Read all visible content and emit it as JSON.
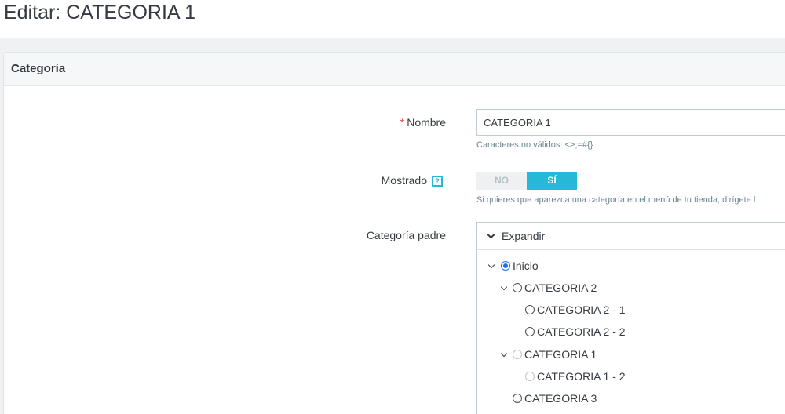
{
  "page": {
    "title": "Editar: CATEGORIA 1"
  },
  "panel": {
    "heading": "Categoría"
  },
  "form": {
    "name": {
      "required_mark": "*",
      "label": "Nombre",
      "value": "CATEGORIA 1",
      "hint": "Caracteres no válidos: <>;=#{}"
    },
    "displayed": {
      "label": "Mostrado",
      "help_icon": "?",
      "no_label": "NO",
      "yes_label": "SÍ",
      "selected": "SÍ",
      "hint": "Si quieres que aparezca una categoría en el menú de tu tienda, dirígete l"
    },
    "parent": {
      "label": "Categoría padre",
      "expand_label": "Expandir",
      "tree": [
        {
          "label": "Inicio",
          "checked": true,
          "disabled": false
        },
        {
          "label": "CATEGORIA 2",
          "checked": false,
          "disabled": false
        },
        {
          "label": "CATEGORIA 2 - 1",
          "checked": false,
          "disabled": false
        },
        {
          "label": "CATEGORIA 2 - 2",
          "checked": false,
          "disabled": false
        },
        {
          "label": "CATEGORIA 1",
          "checked": false,
          "disabled": true
        },
        {
          "label": "CATEGORIA 1 - 2",
          "checked": false,
          "disabled": true
        },
        {
          "label": "CATEGORIA 3",
          "checked": false,
          "disabled": false
        }
      ]
    }
  },
  "colors": {
    "accent": "#25b9d7",
    "required": "#e44836",
    "radio_checked": "#1a73e8"
  }
}
